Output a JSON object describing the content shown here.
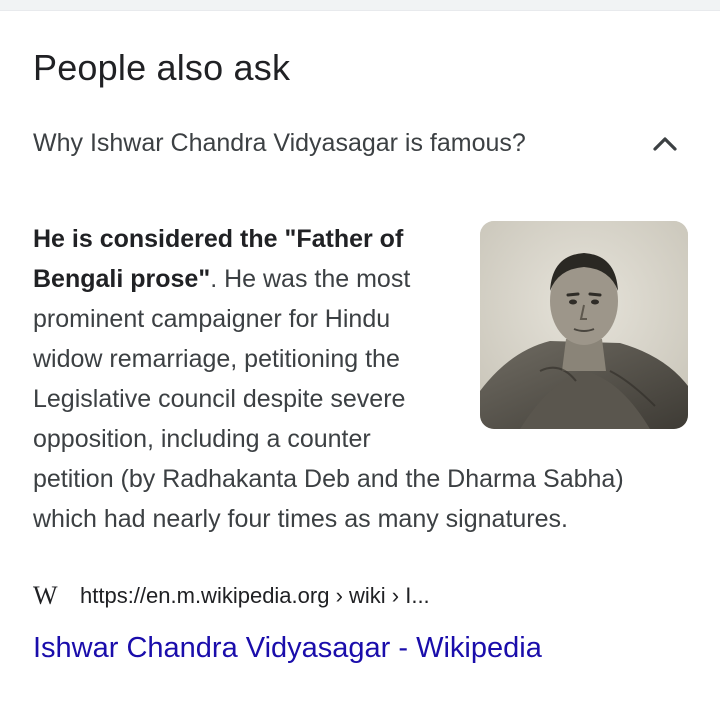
{
  "section": {
    "heading": "People also ask"
  },
  "question": {
    "text": "Why Ishwar Chandra Vidyasagar is famous?",
    "expanded": true,
    "icon": "chevron-up-icon"
  },
  "answer": {
    "bold_text": "He is considered the \"Father of Bengali prose\"",
    "body_text": ". He was the most prominent campaigner for Hindu widow remarriage, petitioning the Legislative council despite severe opposition, including a counter petition (by Radhakanta Deb and the Dharma Sabha) which had nearly four times as many signatures."
  },
  "source": {
    "icon": "wikipedia-icon",
    "icon_glyph": "W",
    "url": "https://en.m.wikipedia.org › wiki › I...",
    "title": "Ishwar Chandra Vidyasagar - Wikipedia"
  },
  "colors": {
    "link": "#1a0dab",
    "text": "#3c4043",
    "heading": "#202124"
  }
}
